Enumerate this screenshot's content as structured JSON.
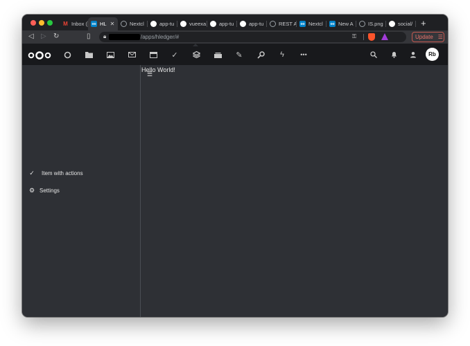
{
  "browser": {
    "tabs": [
      {
        "label": "Inbox (",
        "favicon": "gmail-icon",
        "color": "#ffffff"
      },
      {
        "label": "HL",
        "favicon": "nextcloud-icon",
        "color": "#0082c9",
        "active": true
      },
      {
        "label": "Nextcl",
        "favicon": "globe-icon",
        "color": "#5f6368"
      },
      {
        "label": "app-tu",
        "favicon": "github-icon",
        "color": "#ffffff"
      },
      {
        "label": "vueexa",
        "favicon": "github-icon",
        "color": "#ffffff"
      },
      {
        "label": "app-tu",
        "favicon": "github-icon",
        "color": "#ffffff"
      },
      {
        "label": "app-tu",
        "favicon": "github-icon",
        "color": "#ffffff"
      },
      {
        "label": "REST A",
        "favicon": "globe-icon",
        "color": "#5f6368"
      },
      {
        "label": "Nextcl",
        "favicon": "nextcloud-icon",
        "color": "#0082c9"
      },
      {
        "label": "New A",
        "favicon": "nextcloud-icon",
        "color": "#0082c9"
      },
      {
        "label": "IS.png",
        "favicon": "globe-icon",
        "color": "#5f6368"
      },
      {
        "label": "social/",
        "favicon": "github-icon",
        "color": "#ffffff"
      }
    ],
    "url": "/apps/hledger/#",
    "update_label": "Update"
  },
  "header": {
    "apps": [
      "dashboard-icon",
      "files-icon",
      "photos-icon",
      "mail-icon",
      "calendar-icon",
      "tasks-icon",
      "hledger-icon",
      "deck-icon",
      "notes-icon",
      "passwords-icon",
      "activity-icon",
      "more-apps-icon"
    ],
    "avatar_initials": "Rb"
  },
  "nav": {
    "items": [
      {
        "label": "Item with actions",
        "icon": "check-icon"
      },
      {
        "label": "Settings",
        "icon": "gear-icon"
      }
    ]
  },
  "main": {
    "text": "Hello World!"
  }
}
